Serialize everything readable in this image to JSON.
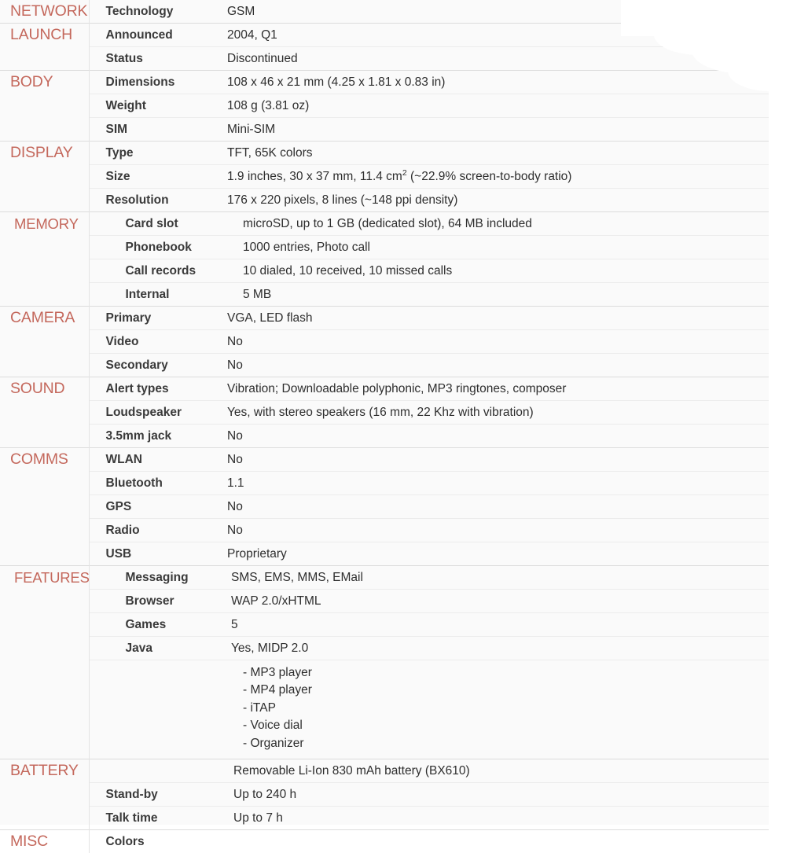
{
  "colors": {
    "category": "#c4685c",
    "key": "#3a3a3a",
    "value": "#2e2e2e",
    "sheet_background": "#fafafa",
    "row_divider": "#ececec",
    "section_divider": "#dcdcdc",
    "column_divider": "#e4e4e4"
  },
  "sections": [
    {
      "category": "NETWORK",
      "rows": [
        {
          "key": "Technology",
          "value": "GSM"
        }
      ]
    },
    {
      "category": "LAUNCH",
      "rows": [
        {
          "key": "Announced",
          "value": "2004, Q1"
        },
        {
          "key": "Status",
          "value": "Discontinued"
        }
      ]
    },
    {
      "category": "BODY",
      "rows": [
        {
          "key": "Dimensions",
          "value": "108 x 46 x 21 mm (4.25 x 1.81 x 0.83 in)"
        },
        {
          "key": "Weight",
          "value": "108 g (3.81 oz)"
        },
        {
          "key": "SIM",
          "value": "Mini-SIM"
        }
      ]
    },
    {
      "category": "DISPLAY",
      "rows": [
        {
          "key": "Type",
          "value": "TFT, 65K colors"
        },
        {
          "key": "Size",
          "value_prefix": "1.9 inches, 30 x 37 mm, 11.4 cm",
          "value_sup": "2",
          "value_suffix": " (~22.9% screen-to-body ratio)"
        },
        {
          "key": "Resolution",
          "value": "176 x 220 pixels, 8 lines (~148 ppi density)"
        }
      ]
    },
    {
      "category": "MEMORY",
      "rows": [
        {
          "key": "Card slot",
          "value": "microSD, up to 1 GB (dedicated slot), 64 MB included"
        },
        {
          "key": "Phonebook",
          "value": "1000 entries, Photo call"
        },
        {
          "key": "Call records",
          "value": "10 dialed, 10 received, 10 missed calls"
        },
        {
          "key": "Internal",
          "value": "5 MB"
        }
      ]
    },
    {
      "category": "CAMERA",
      "rows": [
        {
          "key": "Primary",
          "value": "VGA, LED flash"
        },
        {
          "key": "Video",
          "value": "No"
        },
        {
          "key": "Secondary",
          "value": "No"
        }
      ]
    },
    {
      "category": "SOUND",
      "rows": [
        {
          "key": "Alert types",
          "value": "Vibration; Downloadable polyphonic, MP3 ringtones, composer"
        },
        {
          "key": "Loudspeaker",
          "value": "Yes, with stereo speakers (16 mm, 22 Khz with vibration)"
        },
        {
          "key": "3.5mm jack",
          "value": "No"
        }
      ]
    },
    {
      "category": "COMMS",
      "rows": [
        {
          "key": "WLAN",
          "value": "No"
        },
        {
          "key": "Bluetooth",
          "value": "1.1"
        },
        {
          "key": "GPS",
          "value": "No"
        },
        {
          "key": "Radio",
          "value": "No"
        },
        {
          "key": "USB",
          "value": "Proprietary"
        }
      ]
    },
    {
      "category": "FEATURES",
      "rows": [
        {
          "key": "Messaging",
          "value": "SMS, EMS, MMS, EMail"
        },
        {
          "key": "Browser",
          "value": "WAP 2.0/xHTML"
        },
        {
          "key": "Games",
          "value": "5"
        },
        {
          "key": "Java",
          "value": "Yes, MIDP 2.0"
        },
        {
          "key": "",
          "bullets": [
            "- MP3 player",
            "- MP4 player",
            "- iTAP",
            "- Voice dial",
            "- Organizer"
          ]
        }
      ]
    },
    {
      "category": "BATTERY",
      "rows": [
        {
          "key": "",
          "value": "Removable Li-Ion 830 mAh battery (BX610)"
        },
        {
          "key": "Stand-by",
          "value": "Up to 240 h"
        },
        {
          "key": "Talk time",
          "value": "Up to 7 h"
        }
      ]
    },
    {
      "category": "MISC",
      "rows": [
        {
          "key": "Colors",
          "value": ""
        }
      ]
    }
  ]
}
